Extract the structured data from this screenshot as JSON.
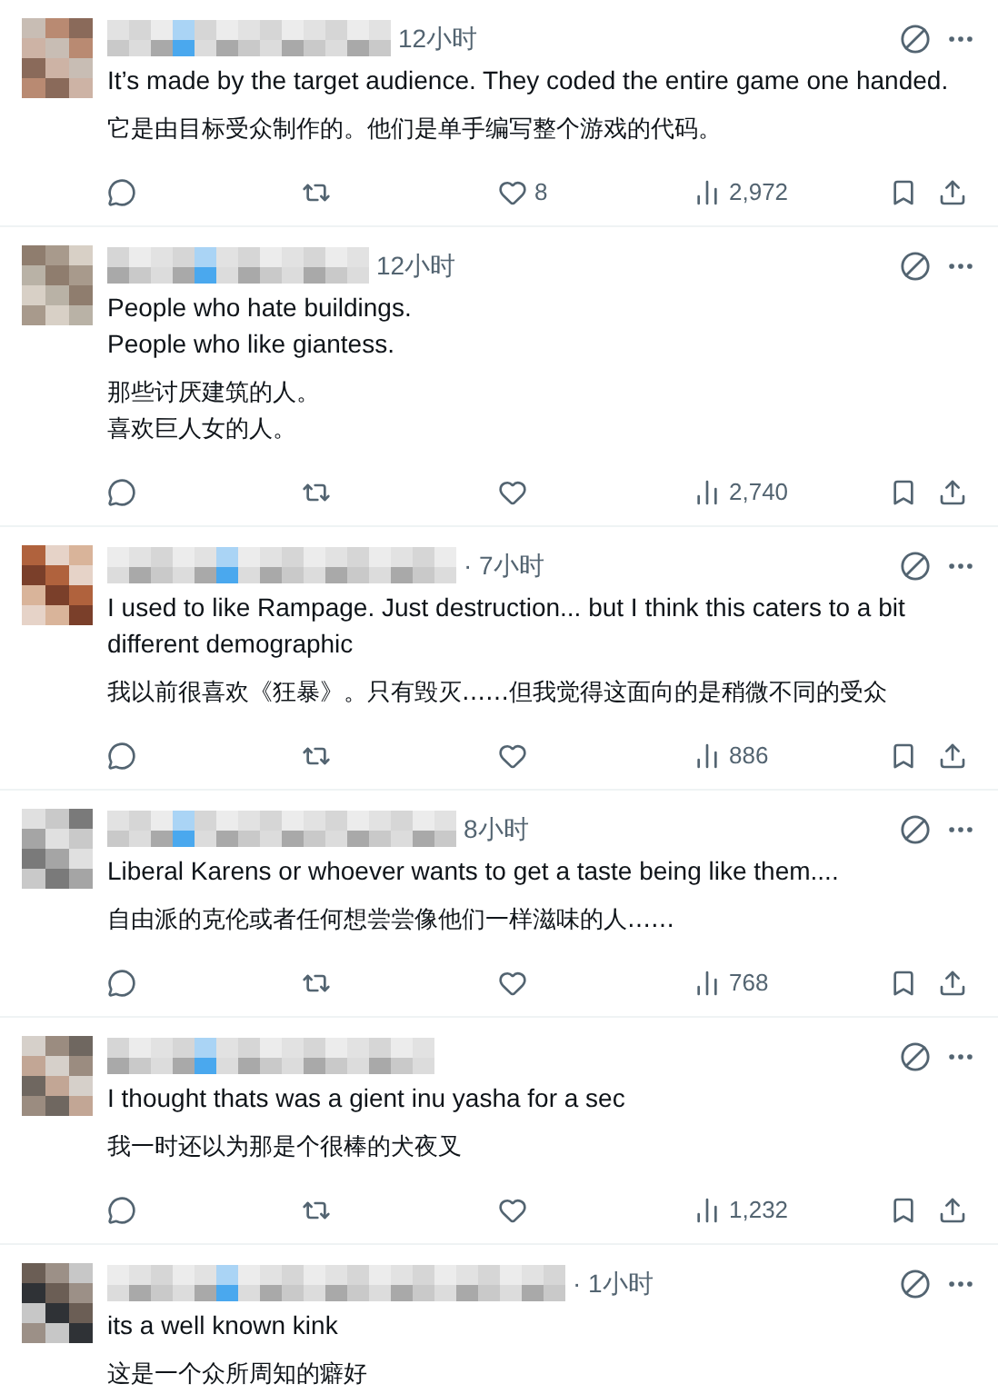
{
  "tweets": [
    {
      "time": "12小时",
      "text": [
        "It’s made by the target audience. They coded the entire game one handed."
      ],
      "translation": [
        "它是由目标受众制作的。他们是单手编写整个游戏的代码。"
      ],
      "likes": "8",
      "views": "2,972"
    },
    {
      "time": "12小时",
      "text": [
        "People who hate buildings.",
        "People who like giantess."
      ],
      "translation": [
        "那些讨厌建筑的人。",
        "喜欢巨人女的人。"
      ],
      "views": "2,740"
    },
    {
      "time": "· 7小时",
      "text": [
        "I used to like Rampage. Just destruction... but I think this caters to a bit different demographic"
      ],
      "translation": [
        "我以前很喜欢《狂暴》。只有毁灭……但我觉得这面向的是稍微不同的受众"
      ],
      "views": "886"
    },
    {
      "time": "8小时",
      "text": [
        "Liberal Karens or whoever wants to get a taste being like them...."
      ],
      "translation": [
        "自由派的克伦或者任何想尝尝像他们一样滋味的人……"
      ],
      "views": "768"
    },
    {
      "text": [
        "I thought thats was a gient inu yasha for a sec"
      ],
      "translation": [
        "我一时还以为那是个很棒的犬夜叉"
      ],
      "views": "1,232"
    },
    {
      "time": "· 1小时",
      "text": [
        "its a well known kink"
      ],
      "translation": [
        "这是一个众所周知的癖好"
      ]
    }
  ]
}
